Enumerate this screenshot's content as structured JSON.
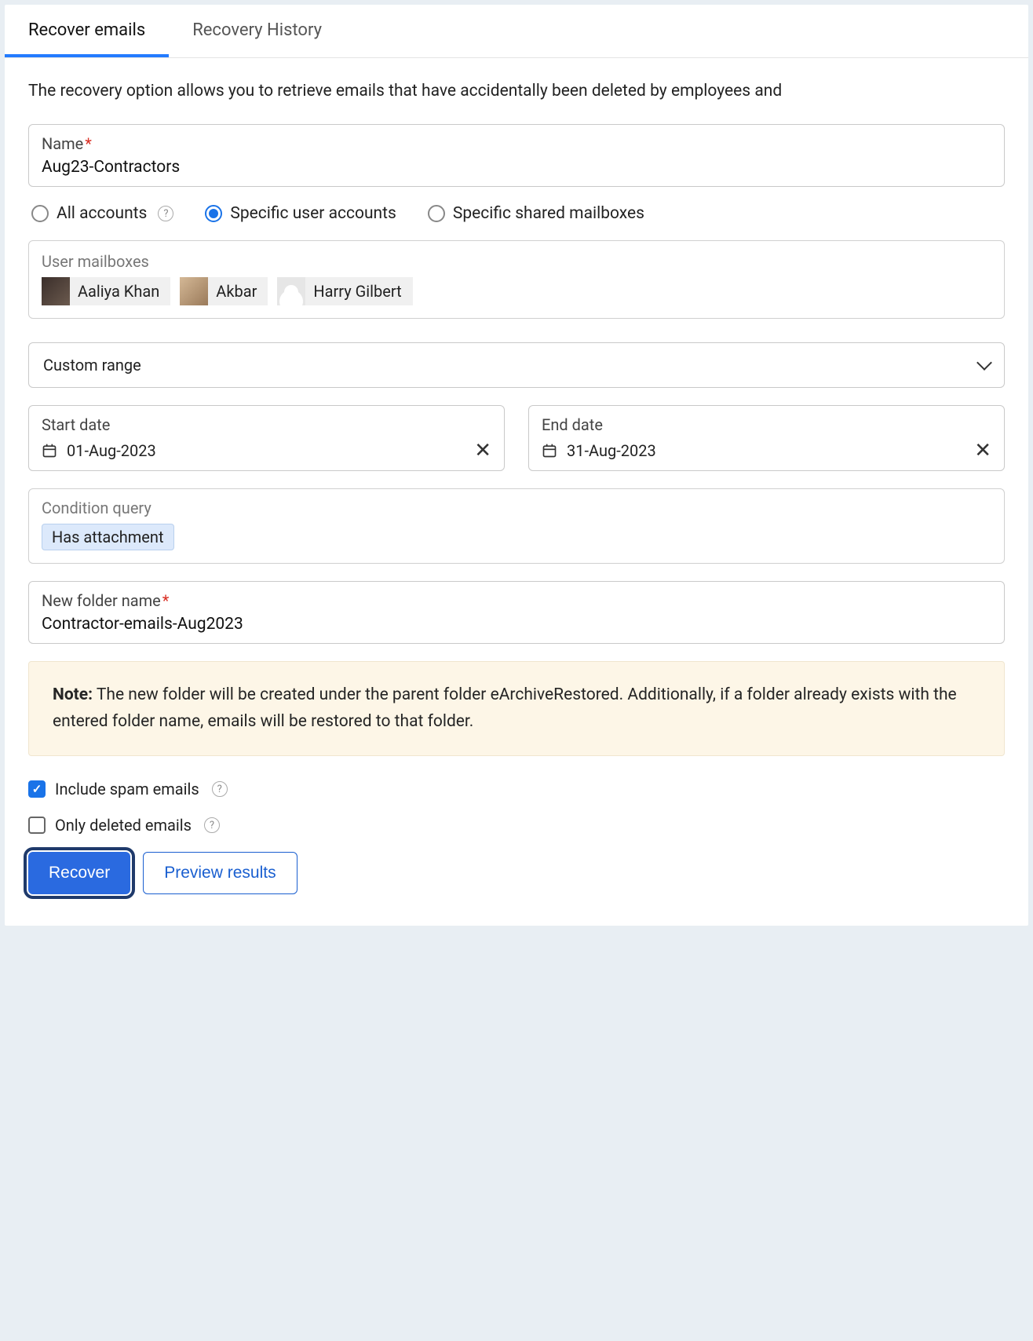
{
  "tabs": {
    "recover": "Recover emails",
    "history": "Recovery History"
  },
  "description": "The recovery option allows you to retrieve emails that have accidentally been deleted by employees and",
  "nameField": {
    "label": "Name",
    "value": "Aug23-Contractors"
  },
  "scope": {
    "all": "All accounts",
    "specific_users": "Specific user accounts",
    "specific_shared": "Specific shared mailboxes"
  },
  "mailboxes": {
    "label": "User mailboxes",
    "items": [
      "Aaliya Khan",
      "Akbar",
      "Harry Gilbert"
    ]
  },
  "rangeSelect": "Custom range",
  "dates": {
    "start_label": "Start date",
    "start_value": "01-Aug-2023",
    "end_label": "End date",
    "end_value": "31-Aug-2023"
  },
  "condition": {
    "label": "Condition query",
    "chip": "Has attachment"
  },
  "folderField": {
    "label": "New folder name",
    "value": "Contractor-emails-Aug2023"
  },
  "note": {
    "prefix": "Note:",
    "text": " The new folder will be created under the parent folder eArchiveRestored. Additionally, if a folder already exists with the entered folder name, emails will be restored to that folder."
  },
  "checks": {
    "spam": "Include spam emails",
    "deleted": "Only deleted emails"
  },
  "buttons": {
    "recover": "Recover",
    "preview": "Preview results"
  }
}
